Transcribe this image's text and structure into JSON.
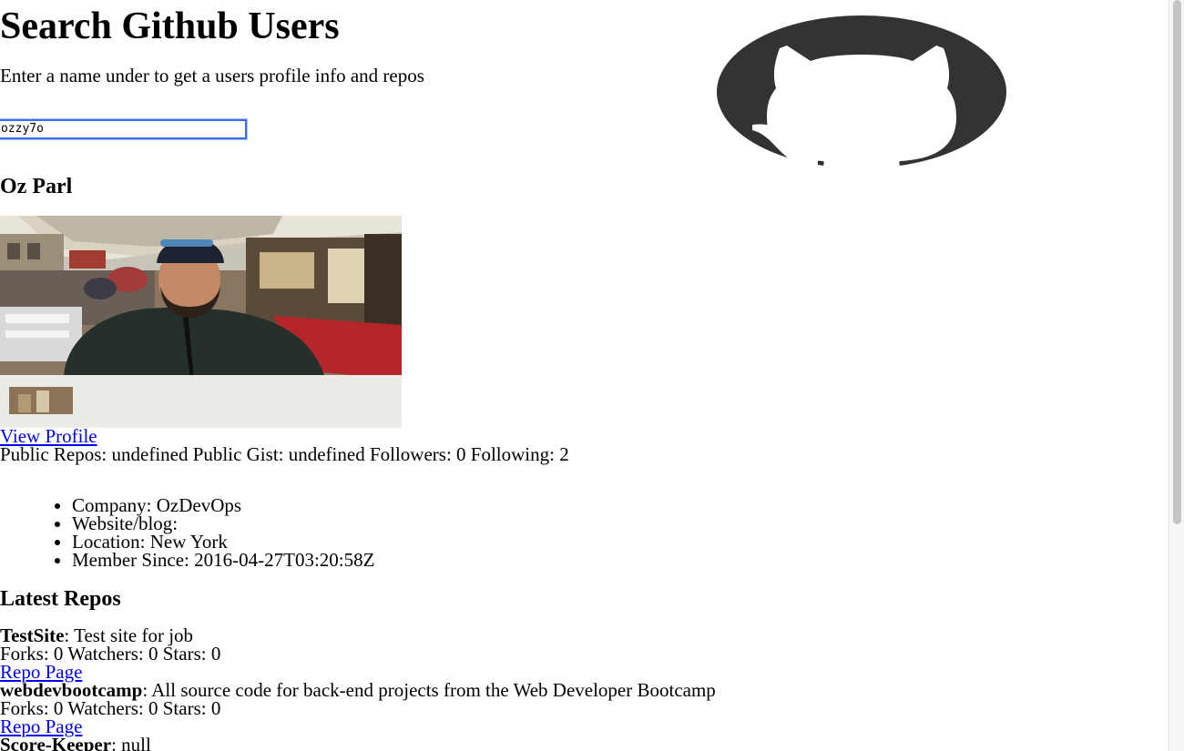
{
  "header": {
    "title": "Search Github Users",
    "intro": "Enter a name under to get a users profile info and repos"
  },
  "search": {
    "value": "ozzy7o",
    "placeholder": ""
  },
  "logo": {
    "icon": "github-octocat-logo",
    "color": "#333333"
  },
  "profile": {
    "name": "Oz Parl",
    "avatar_alt": "avatar",
    "view_profile_label": "View Profile",
    "stats": "Public Repos: undefined Public Gist: undefined Followers: 0 Following: 2",
    "details": [
      "Company: OzDevOps",
      "Website/blog:",
      "Location: New York",
      "Member Since: 2016-04-27T03:20:58Z"
    ]
  },
  "repos": {
    "heading": "Latest Repos",
    "items": [
      {
        "name": "TestSite",
        "description": ": Test site for job",
        "counts": "Forks: 0 Watchers: 0 Stars: 0",
        "link_label": "Repo Page"
      },
      {
        "name": "webdevbootcamp",
        "description": ": All source code for back-end projects from the Web Developer Bootcamp",
        "counts": "Forks: 0 Watchers: 0 Stars: 0",
        "link_label": "Repo Page"
      },
      {
        "name": "Score-Keeper",
        "description": ": null"
      }
    ]
  },
  "colors": {
    "link": "#0000ee",
    "focus_ring": "#3b6bf0"
  }
}
